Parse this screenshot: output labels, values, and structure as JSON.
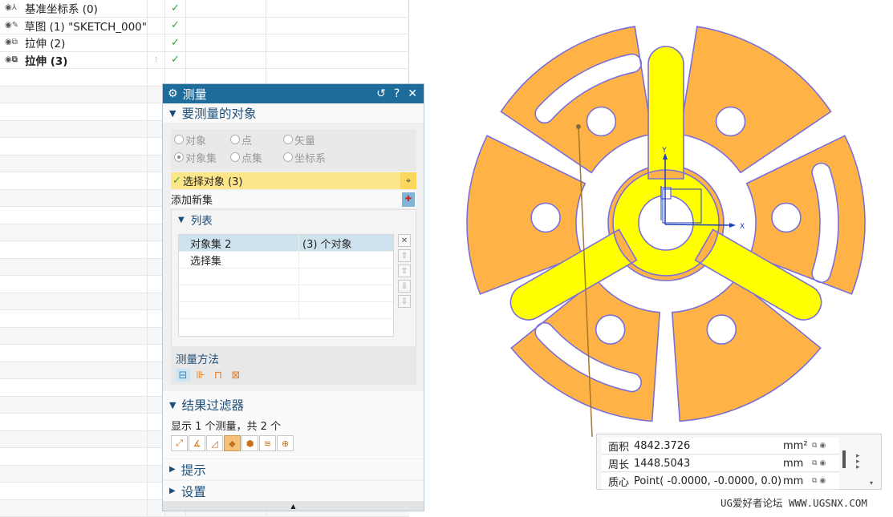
{
  "navigator": {
    "rows": [
      {
        "name": "基准坐标系 (0)",
        "icon": "datum-csys-icon",
        "check": "✓"
      },
      {
        "name": "草图 (1) \"SKETCH_000\"",
        "icon": "sketch-icon",
        "check": "✓"
      },
      {
        "name": "拉伸 (2)",
        "icon": "extrude-icon",
        "check": "✓"
      },
      {
        "name": "拉伸 (3)",
        "icon": "extrude-icon",
        "check": "✓",
        "bold": true
      }
    ]
  },
  "dialog": {
    "title": "测量",
    "title_btns": [
      "↺",
      "?",
      "✕"
    ],
    "section_objects": "要测量的对象",
    "radios_row1": [
      "对象",
      "点",
      "矢量"
    ],
    "radios_row2": [
      "对象集",
      "点集",
      "坐标系"
    ],
    "select_label": "选择对象 (3)",
    "add_new_set": "添加新集",
    "list_label": "列表",
    "list_rows": [
      {
        "name": "对象集 2",
        "value": "(3) 个对象"
      },
      {
        "name": "选择集",
        "value": ""
      }
    ],
    "method_label": "测量方法",
    "section_filter": "结果过滤器",
    "filter_info": "显示 1 个测量，共 2 个",
    "section_tips": "提示",
    "section_settings": "设置"
  },
  "results": {
    "rows": [
      {
        "label": "面积",
        "value": "4842.3726",
        "unit": "mm²"
      },
      {
        "label": "周长",
        "value": "1448.5043",
        "unit": "mm"
      },
      {
        "label": "质心",
        "value": "Point( -0.0000, -0.0000, 0.0)",
        "unit": "mm"
      }
    ]
  },
  "graphics": {
    "axis_x": "X",
    "axis_y": "Y",
    "colors": {
      "part": "#ffb347",
      "highlight": "#ffff00",
      "edge": "#7a6fd9",
      "title_bar": "#1e6c9c"
    }
  },
  "watermark": "UG爱好者论坛 WWW.UGSNX.COM"
}
